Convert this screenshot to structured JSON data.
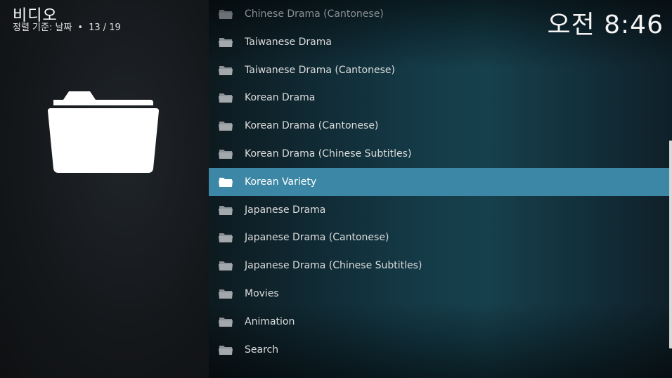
{
  "header": {
    "title": "비디오",
    "sort_label": "정렬 기준: 날짜",
    "separator": "•",
    "position": "13 / 19"
  },
  "clock": "오전 8:46",
  "list": {
    "items": [
      {
        "label": "Chinese Drama (Cantonese)",
        "icon": "folder-icon"
      },
      {
        "label": "Taiwanese Drama",
        "icon": "folder-icon"
      },
      {
        "label": "Taiwanese Drama (Cantonese)",
        "icon": "folder-icon"
      },
      {
        "label": "Korean Drama",
        "icon": "folder-icon"
      },
      {
        "label": "Korean Drama (Cantonese)",
        "icon": "folder-icon"
      },
      {
        "label": "Korean Drama (Chinese Subtitles)",
        "icon": "folder-icon"
      },
      {
        "label": "Korean Variety",
        "icon": "folder-icon"
      },
      {
        "label": "Japanese Drama",
        "icon": "folder-icon"
      },
      {
        "label": "Japanese Drama (Cantonese)",
        "icon": "folder-icon"
      },
      {
        "label": "Japanese Drama (Chinese Subtitles)",
        "icon": "folder-icon"
      },
      {
        "label": "Movies",
        "icon": "folder-icon"
      },
      {
        "label": "Animation",
        "icon": "folder-icon"
      },
      {
        "label": "Search",
        "icon": "folder-icon"
      }
    ],
    "selected_label": "Korean Variety"
  },
  "colors": {
    "selection": "#3b87a5",
    "text": "#dcdcdc"
  }
}
